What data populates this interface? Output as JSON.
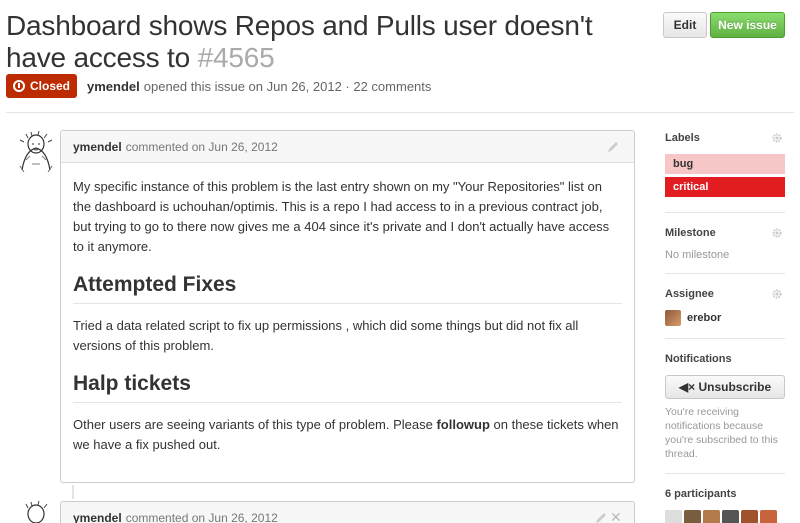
{
  "header": {
    "title": "Dashboard shows Repos and Pulls user doesn't have access to",
    "number": "#4565",
    "edit_label": "Edit",
    "new_issue_label": "New issue"
  },
  "meta": {
    "state": "Closed",
    "author": "ymendel",
    "text": "opened this issue on Jun 26, 2012 · 22 comments"
  },
  "comments": [
    {
      "author": "ymendel",
      "date": "commented on Jun 26, 2012",
      "para1": "My specific instance of this problem is the last entry shown on my \"Your Repositories\" list on the dashboard is uchouhan/optimis. This is a repo I had access to in a previous contract job, but trying to go to there now gives me a 404 since it's private and I don't actually have access to it anymore.",
      "heading1": "Attempted Fixes",
      "para2": "Tried a data related script to fix up permissions , which did some things but did not fix all versions of this problem.",
      "heading2": "Halp tickets",
      "para3_pre": "Other users are seeing variants of this type of problem. Please ",
      "para3_bold": "followup",
      "para3_post": " on these tickets when we have a fix pushed out."
    },
    {
      "author": "ymendel",
      "date": "commented on Jun 26, 2012"
    }
  ],
  "sidebar": {
    "labels_title": "Labels",
    "labels": [
      {
        "name": "bug",
        "color": "#f7c6c7"
      },
      {
        "name": "critical",
        "color": "#e11d21"
      }
    ],
    "milestone_title": "Milestone",
    "milestone_value": "No milestone",
    "assignee_title": "Assignee",
    "assignee_name": "erebor",
    "notifications_title": "Notifications",
    "unsubscribe_label": "Unsubscribe",
    "notifications_note": "You're receiving notifications because you're subscribed to this thread.",
    "participants_title": "6 participants"
  },
  "colors": {
    "closed_badge": "#bd2c00",
    "new_issue_button": "#60b044"
  }
}
